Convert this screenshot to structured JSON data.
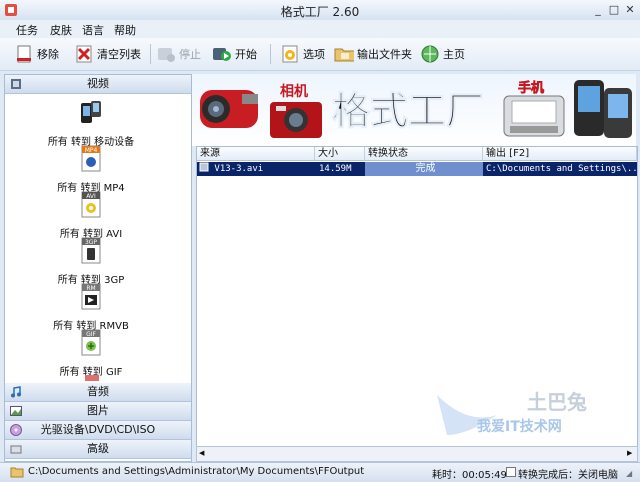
{
  "window": {
    "title": "格式工厂 2.60"
  },
  "menu": [
    "任务",
    "皮肤",
    "语言",
    "帮助"
  ],
  "toolbar": {
    "remove": "移除",
    "clear_list": "清空列表",
    "stop": "停止",
    "start": "开始",
    "options": "选项",
    "output_folder": "输出文件夹",
    "home": "主页"
  },
  "categories": {
    "video": "视频",
    "audio": "音频",
    "image": "图片",
    "optical": "光驱设备\\DVD\\CD\\ISO",
    "advanced": "高级"
  },
  "formats": [
    {
      "label": "所有 转到 移动设备",
      "badge": ""
    },
    {
      "label": "所有 转到 MP4",
      "badge": "MP4"
    },
    {
      "label": "所有 转到 AVI",
      "badge": "AVI"
    },
    {
      "label": "所有 转到 3GP",
      "badge": "3GP"
    },
    {
      "label": "所有 转到 RMVB",
      "badge": "RM"
    },
    {
      "label": "所有 转到 GIF",
      "badge": "GIF"
    }
  ],
  "banner": {
    "title": "格式工厂",
    "camera_label": "相机",
    "phone_label": "手机"
  },
  "table": {
    "headers": [
      "来源",
      "大小",
      "转换状态",
      "输出 [F2]"
    ],
    "rows": [
      {
        "source": "V13-3.avi",
        "size": "14.59M",
        "status": "完成",
        "output": "C:\\Documents and Settings\\..."
      }
    ]
  },
  "status": {
    "path": "C:\\Documents and Settings\\Administrator\\My Documents\\FFOutput",
    "elapsed": "耗时：00:05:49",
    "after_complete": "转换完成后：关闭电脑"
  },
  "watermark": {
    "brand": "土巴兔",
    "site": "我爱IT技术网"
  },
  "colors": {
    "selection": "#0a246a",
    "status_done": "#6f8fcf",
    "accent": "#c8171e"
  }
}
